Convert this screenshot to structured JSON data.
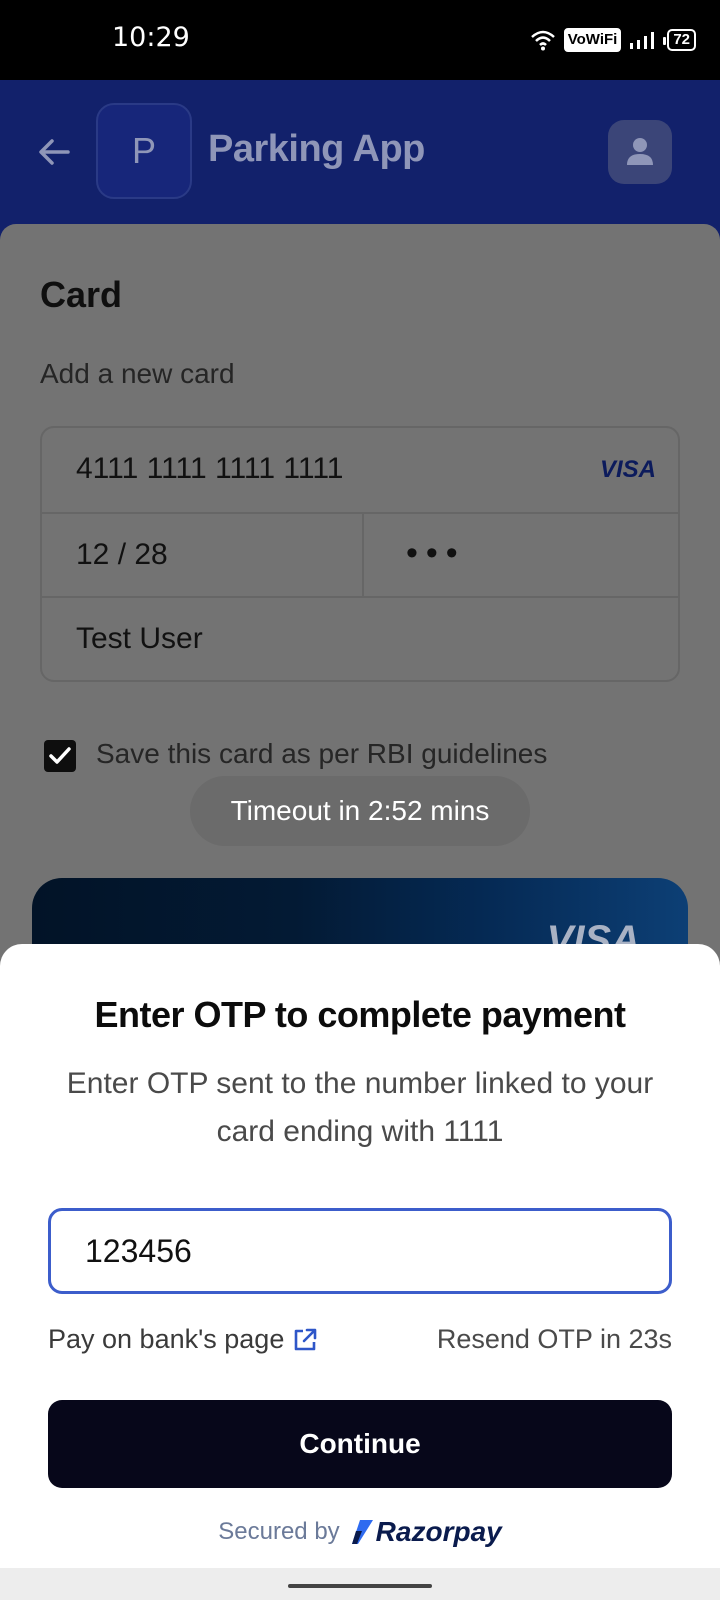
{
  "status_bar": {
    "time": "10:29",
    "vowifi": "VoWiFi",
    "battery": "72"
  },
  "header": {
    "logo_letter": "P",
    "title": "Parking App"
  },
  "card_section": {
    "title": "Card",
    "subtitle": "Add a new card",
    "card_number": "4111 1111 1111 1111",
    "brand": "VISA",
    "expiry": "12 / 28",
    "cvv_masked": "•••",
    "name": "Test User",
    "save_label": "Save this card as per RBI guidelines",
    "save_checked": true,
    "timeout": "Timeout in 2:52 mins",
    "preview_brand": "VISA"
  },
  "otp_sheet": {
    "title": "Enter OTP to complete payment",
    "description": "Enter OTP sent to the number linked to your card ending with 1111",
    "otp_value": "123456",
    "bank_link": "Pay on bank's page",
    "resend": "Resend OTP in 23s",
    "continue_label": "Continue",
    "secured_by": "Secured by",
    "provider": "Razorpay"
  },
  "colors": {
    "header_bg": "#12216b",
    "accent": "#3c5dcb",
    "button_bg": "#07071a",
    "overlay_dim": "#737373"
  }
}
